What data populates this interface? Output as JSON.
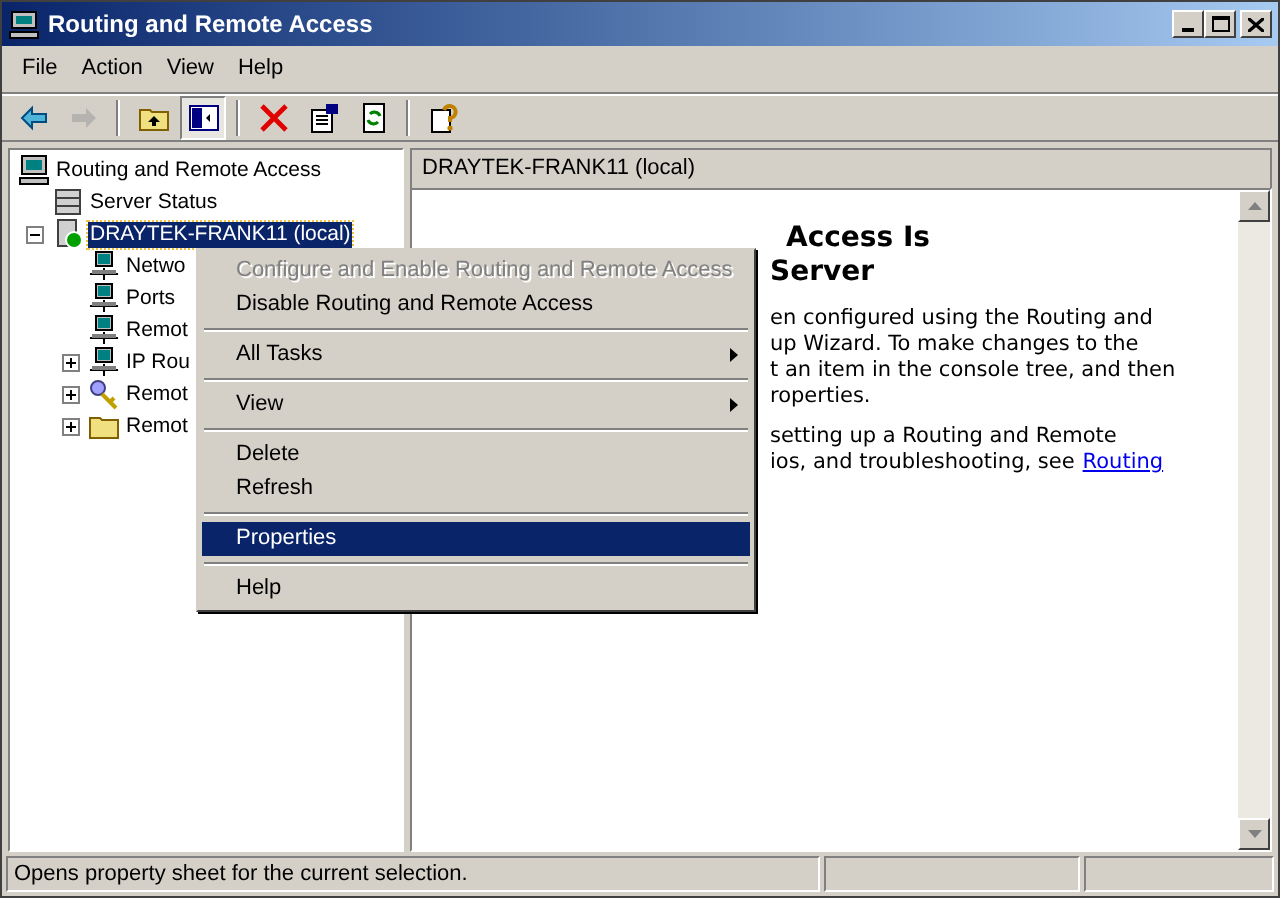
{
  "window": {
    "title": "Routing and Remote Access"
  },
  "menu_bar": [
    {
      "label": "File"
    },
    {
      "label": "Action"
    },
    {
      "label": "View"
    },
    {
      "label": "Help"
    }
  ],
  "toolbar": [
    {
      "kind": "back",
      "disabled": false,
      "pressed": false
    },
    {
      "kind": "forward",
      "disabled": true,
      "pressed": false
    },
    {
      "kind": "separator"
    },
    {
      "kind": "up",
      "disabled": false,
      "pressed": false
    },
    {
      "kind": "tree-toggle",
      "disabled": false,
      "pressed": true
    },
    {
      "kind": "separator"
    },
    {
      "kind": "delete",
      "disabled": false,
      "pressed": false
    },
    {
      "kind": "properties",
      "disabled": false,
      "pressed": false
    },
    {
      "kind": "refresh",
      "disabled": false,
      "pressed": false
    },
    {
      "kind": "separator"
    },
    {
      "kind": "help",
      "disabled": false,
      "pressed": false
    }
  ],
  "tree": {
    "label": "Routing and Remote Access",
    "kind": "computer",
    "selected": false,
    "children": [
      {
        "label": "Server Status",
        "kind": "servers",
        "selected": false
      },
      {
        "label": "DRAYTEK-FRANK11 (local)",
        "kind": "server",
        "expanded": true,
        "selected": true,
        "children": [
          {
            "label": "Netwo",
            "kind": "network",
            "selected": false
          },
          {
            "label": "Ports",
            "kind": "network",
            "selected": false
          },
          {
            "label": "Remot",
            "kind": "network",
            "selected": false
          },
          {
            "label": "IP Rou",
            "kind": "network",
            "expanded": false,
            "selected": false
          },
          {
            "label": "Remot",
            "kind": "key",
            "expanded": false,
            "selected": false
          },
          {
            "label": "Remot",
            "kind": "folder",
            "expanded": false,
            "selected": false
          }
        ]
      }
    ]
  },
  "details": {
    "header": "DRAYTEK-FRANK11 (local)",
    "heading_lines": [
      "Access Is",
      "Server"
    ],
    "paragraphs": [
      {
        "lines": [
          "en configured using the Routing and",
          "up Wizard. To make changes to the",
          "t an item in the console tree, and then",
          "roperties."
        ]
      },
      {
        "lines": [
          "setting up a Routing and Remote",
          "ios, and troubleshooting, see"
        ],
        "link": "Routing"
      }
    ]
  },
  "context_menu": [
    {
      "kind": "item",
      "label": "Configure and Enable Routing and Remote Access",
      "disabled": true,
      "selected": false,
      "submenu": false
    },
    {
      "kind": "item",
      "label": "Disable Routing and Remote Access",
      "disabled": false,
      "selected": false,
      "submenu": false
    },
    {
      "kind": "separator"
    },
    {
      "kind": "item",
      "label": "All Tasks",
      "disabled": false,
      "selected": false,
      "submenu": true
    },
    {
      "kind": "separator"
    },
    {
      "kind": "item",
      "label": "View",
      "disabled": false,
      "selected": false,
      "submenu": true
    },
    {
      "kind": "separator"
    },
    {
      "kind": "item",
      "label": "Delete",
      "disabled": false,
      "selected": false,
      "submenu": false
    },
    {
      "kind": "item",
      "label": "Refresh",
      "disabled": false,
      "selected": false,
      "submenu": false
    },
    {
      "kind": "separator"
    },
    {
      "kind": "item",
      "label": "Properties",
      "disabled": false,
      "selected": true,
      "submenu": false
    },
    {
      "kind": "separator"
    },
    {
      "kind": "item",
      "label": "Help",
      "disabled": false,
      "selected": false,
      "submenu": false
    }
  ],
  "status_bar": {
    "text": "Opens property sheet for the current selection."
  }
}
